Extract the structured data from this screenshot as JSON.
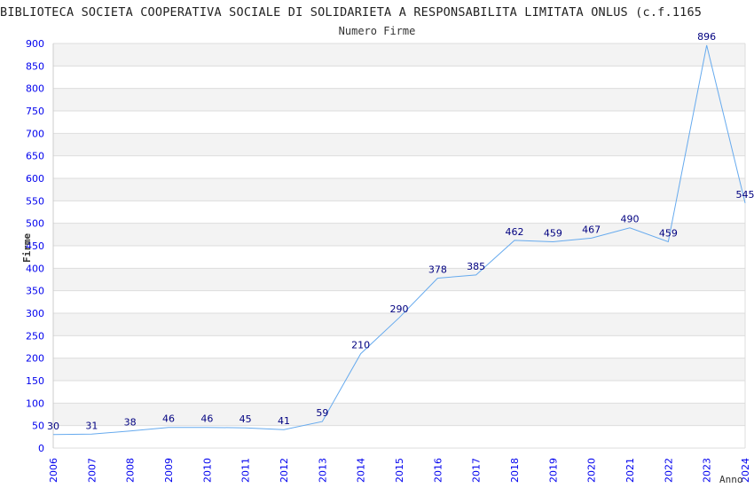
{
  "chart_data": {
    "type": "line",
    "title": "BIBLIOTECA SOCIETA COOPERATIVA SOCIALE DI SOLIDARIETA A RESPONSABILITA LIMITATA ONLUS (c.f.1165",
    "subtitle": "Numero Firme",
    "xlabel": "Anno",
    "ylabel": "Firme",
    "x": [
      "2006",
      "2007",
      "2008",
      "2009",
      "2010",
      "2011",
      "2012",
      "2013",
      "2014",
      "2015",
      "2016",
      "2017",
      "2018",
      "2019",
      "2020",
      "2021",
      "2022",
      "2023",
      "2024"
    ],
    "series": [
      {
        "values": [
          30,
          31,
          38,
          46,
          46,
          45,
          41,
          59,
          210,
          290,
          378,
          385,
          462,
          459,
          467,
          490,
          459,
          896,
          545
        ]
      }
    ],
    "ylim": [
      0,
      900
    ],
    "yticks": [
      0,
      50,
      100,
      150,
      200,
      250,
      300,
      350,
      400,
      450,
      500,
      550,
      600,
      650,
      700,
      750,
      800,
      850,
      900
    ],
    "grid": true,
    "colors": {
      "line": "#66aaee",
      "band": "#f3f3f3",
      "tick_label": "#0000ee",
      "data_label": "#000080"
    }
  }
}
